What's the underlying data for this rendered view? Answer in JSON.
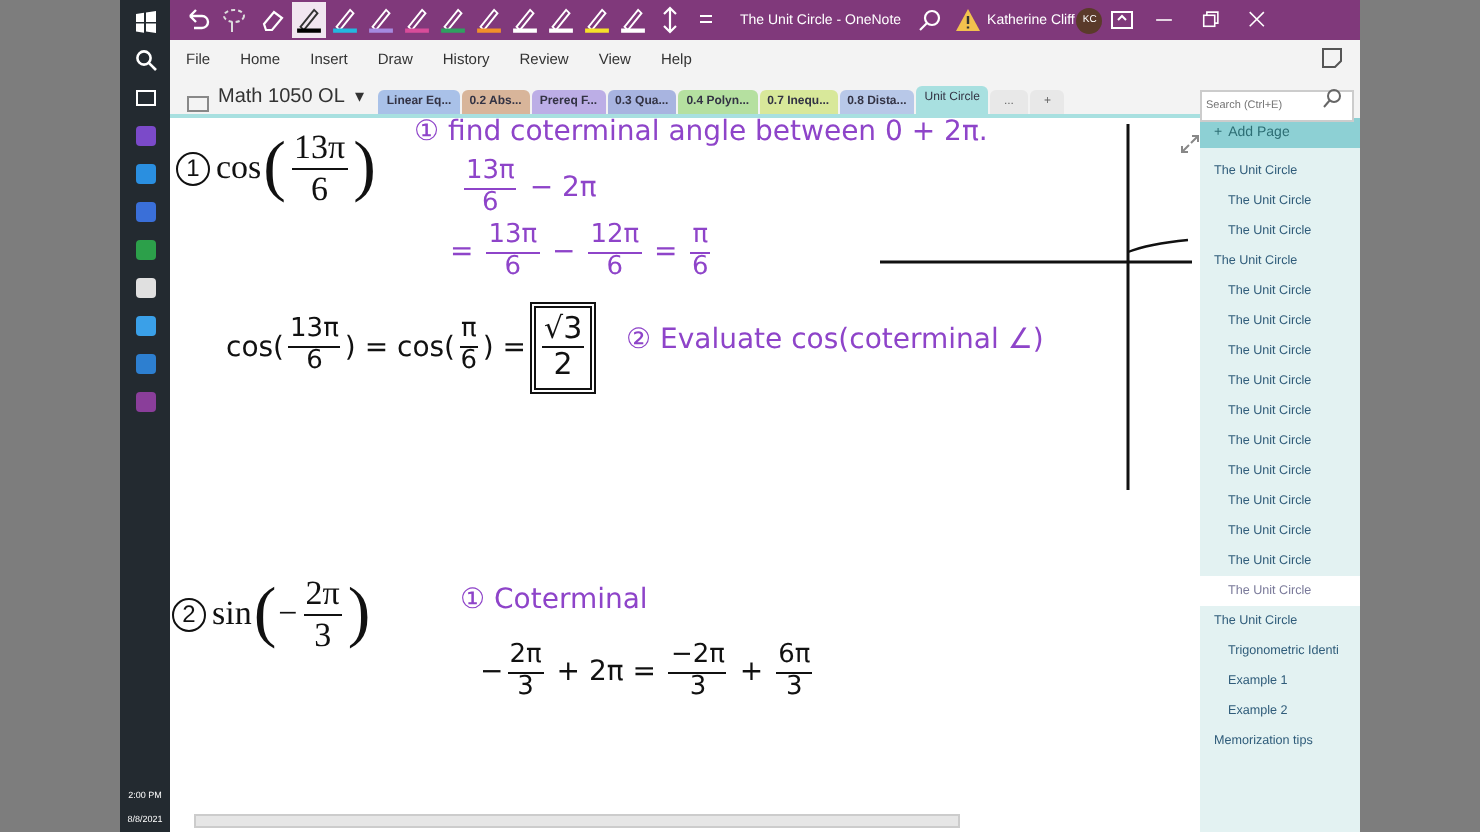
{
  "window": {
    "title": "The Unit Circle - OneNote",
    "user": "Katherine Cliff",
    "initials": "KC"
  },
  "pens": [
    {
      "color": "#000000",
      "selected": true
    },
    {
      "color": "#22b8e0",
      "selected": false
    },
    {
      "color": "#a58ae0",
      "selected": false
    },
    {
      "color": "#d84c9a",
      "selected": false
    },
    {
      "color": "#2fa060",
      "selected": false
    },
    {
      "color": "#f0902a",
      "selected": false
    },
    {
      "color": "#ffffff",
      "selected": false
    },
    {
      "color": "#ffffff",
      "selected": false
    },
    {
      "color": "#f5e02a",
      "selected": false
    },
    {
      "color": "#ffffff",
      "selected": false
    }
  ],
  "menu": [
    "File",
    "Home",
    "Insert",
    "Draw",
    "History",
    "Review",
    "View",
    "Help"
  ],
  "notebook": "Math 1050 OL",
  "notebook_caret": "▾",
  "add_page_glyph": "+",
  "section_tabs": [
    {
      "label": "Linear Eq...",
      "color": "#a9c1e8",
      "selected": false
    },
    {
      "label": "0.2 Abs...",
      "color": "#d8b59a",
      "selected": false
    },
    {
      "label": "Prereq F...",
      "color": "#bcaee6",
      "selected": false
    },
    {
      "label": "0.3 Qua...",
      "color": "#a8b4e0",
      "selected": false
    },
    {
      "label": "0.4 Polyn...",
      "color": "#b5e0a0",
      "selected": false
    },
    {
      "label": "0.7 Inequ...",
      "color": "#d8e89a",
      "selected": false
    },
    {
      "label": "0.8 Dista...",
      "color": "#b8c8e8",
      "selected": false
    },
    {
      "label": "Unit Circle",
      "color": "#a8e0e0",
      "selected": true
    }
  ],
  "overflow_tab": "...",
  "new_tab": "+",
  "search": {
    "placeholder": "Search (Ctrl+E)"
  },
  "notes": [
    {
      "kind": "problem",
      "number": "1",
      "tokens": [
        "cos",
        {
          "big": "("
        },
        {
          "num": "13π",
          "den": "6"
        },
        {
          "big": ")"
        }
      ]
    },
    {
      "kind": "ink",
      "color": "#8e44c9",
      "tokens": [
        "① find coterminal angle between 0 + 2π."
      ]
    },
    {
      "kind": "ink",
      "color": "#8e44c9",
      "tokens": [
        {
          "num": "13π",
          "den": "6"
        },
        " − 2π"
      ]
    },
    {
      "kind": "ink",
      "color": "#8e44c9",
      "tokens": [
        "= ",
        {
          "num": "13π",
          "den": "6"
        },
        " − ",
        {
          "num": "12π",
          "den": "6"
        },
        " = ",
        {
          "num": "π",
          "den": "6"
        }
      ]
    },
    {
      "kind": "ink",
      "color": "#111111",
      "tokens": [
        "cos(",
        {
          "num": "13π",
          "den": "6"
        },
        ") = cos(",
        {
          "num": "π",
          "den": "6"
        },
        ") =",
        {
          "num": "√3",
          "den": "2",
          "boxed": true
        }
      ]
    },
    {
      "kind": "ink",
      "color": "#8e44c9",
      "tokens": [
        "② Evaluate cos(coterminal ∠)"
      ]
    },
    {
      "kind": "problem",
      "number": "2",
      "tokens": [
        "sin",
        {
          "big": "("
        },
        "−",
        {
          "num": "2π",
          "den": "3"
        },
        {
          "big": ")"
        }
      ]
    },
    {
      "kind": "ink",
      "color": "#8e44c9",
      "tokens": [
        "① Coterminal"
      ]
    },
    {
      "kind": "ink",
      "color": "#111111",
      "tokens": [
        "−",
        {
          "num": "2π",
          "den": "3"
        },
        " + 2π = ",
        {
          "num": "−2π",
          "den": "3"
        },
        " + ",
        {
          "num": "6π",
          "den": "3"
        }
      ]
    }
  ],
  "page_list": {
    "add_label": "Add Page",
    "items": [
      {
        "title": "The Unit Circle",
        "selected": false,
        "children": [
          {
            "title": "The Unit Circle",
            "selected": false
          },
          {
            "title": "The Unit Circle",
            "selected": false
          }
        ]
      },
      {
        "title": "The Unit Circle",
        "selected": false,
        "children": [
          {
            "title": "The Unit Circle",
            "selected": false
          },
          {
            "title": "The Unit Circle",
            "selected": false
          },
          {
            "title": "The Unit Circle",
            "selected": false
          },
          {
            "title": "The Unit Circle",
            "selected": false
          },
          {
            "title": "The Unit Circle",
            "selected": false
          },
          {
            "title": "The Unit Circle",
            "selected": false
          },
          {
            "title": "The Unit Circle",
            "selected": false
          },
          {
            "title": "The Unit Circle",
            "selected": false
          },
          {
            "title": "The Unit Circle",
            "selected": false
          },
          {
            "title": "The Unit Circle",
            "selected": false
          },
          {
            "title": "The Unit Circle",
            "selected": true
          }
        ]
      },
      {
        "title": "The Unit Circle",
        "selected": false,
        "children": [
          {
            "title": "Trigonometric Identi",
            "selected": false
          },
          {
            "title": "Example 1",
            "selected": false
          },
          {
            "title": "Example 2",
            "selected": false
          }
        ]
      },
      {
        "title": "Memorization tips",
        "selected": false
      }
    ]
  },
  "taskbar": {
    "time": "2:00 PM",
    "date": "8/8/2021"
  }
}
